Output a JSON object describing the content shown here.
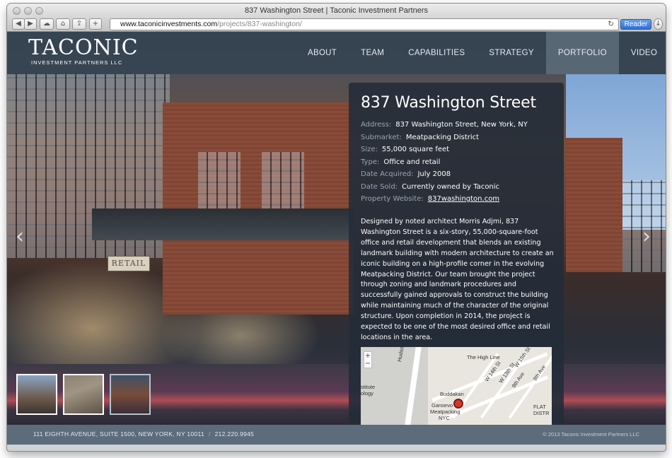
{
  "browser": {
    "window_title": "837 Washington Street | Taconic Investment Partners",
    "url_host": "www.taconicinvestments.com",
    "url_path": "/projects/837-washington/",
    "reader_label": "Reader",
    "icons": [
      "back-icon",
      "forward-icon",
      "cloud-icon",
      "home-icon",
      "share-icon",
      "add-tab-icon",
      "reload-icon",
      "download-icon"
    ]
  },
  "site": {
    "logo_main": "TACONIC",
    "logo_sub": "INVESTMENT PARTNERS LLC",
    "nav": [
      {
        "label": "ABOUT"
      },
      {
        "label": "TEAM"
      },
      {
        "label": "CAPABILITIES"
      },
      {
        "label": "STRATEGY"
      },
      {
        "label": "PORTFOLIO",
        "active": true
      },
      {
        "label": "VIDEO"
      }
    ]
  },
  "hero": {
    "retail_sign": "RETAIL"
  },
  "property": {
    "title": "837 Washington Street",
    "facts": [
      {
        "key": "Address:",
        "value": "837 Washington Street, New York, NY"
      },
      {
        "key": "Submarket:",
        "value": "Meatpacking District"
      },
      {
        "key": "Size:",
        "value": "55,000 square feet"
      },
      {
        "key": "Type:",
        "value": "Office and retail"
      },
      {
        "key": "Date Acquired:",
        "value": "July 2008"
      },
      {
        "key": "Date Sold:",
        "value": "Currently owned by Taconic"
      },
      {
        "key": "Property Website:",
        "value": "837washington.com",
        "link": true
      }
    ],
    "description": "Designed by noted architect Morris Adjmi, 837 Washington Street is a six-story, 55,000-square-foot office and retail development that blends an existing landmark building with modern architecture to create an iconic building on a high-profile corner in the evolving Meatpacking District. Our team brought the project through zoning and landmark procedures and successfully gained approvals to construct the building while maintaining much of the character of the original structure. Upon completion in 2014, the project is expected to be one of the most desired office and retail locations in the area."
  },
  "map": {
    "zoom_in": "+",
    "zoom_out": "−",
    "labels": {
      "hudson": "Hudson Riv",
      "high_line": "The High Line",
      "w14": "W 14th St",
      "w13": "W 13th St",
      "ninth": "9th Ave",
      "eighth": "8th Ave",
      "w15": "W 15th St",
      "buddakan": "Buddakan",
      "gansevoort": "Gansevo",
      "meatpacking": "Meatpacking",
      "nyc": "NYC",
      "flatiron": "FLAT DISTR",
      "institute": "stitute",
      "ology": "ology"
    }
  },
  "footer": {
    "address": "111 EIGHTH AVENUE, SUITE 1500, NEW YORK, NY 10011",
    "separator": "/",
    "phone": "212.220.9945",
    "copyright": "© 2013 Taconic Investment Partners LLC"
  },
  "colors": {
    "header_bg": "#344250",
    "panel_bg": "#232c38",
    "footer_bg": "#5d6c7b",
    "label_gray": "#97a5b3",
    "reader_blue": "#2f6fd6",
    "pin_red": "#d9342b"
  }
}
